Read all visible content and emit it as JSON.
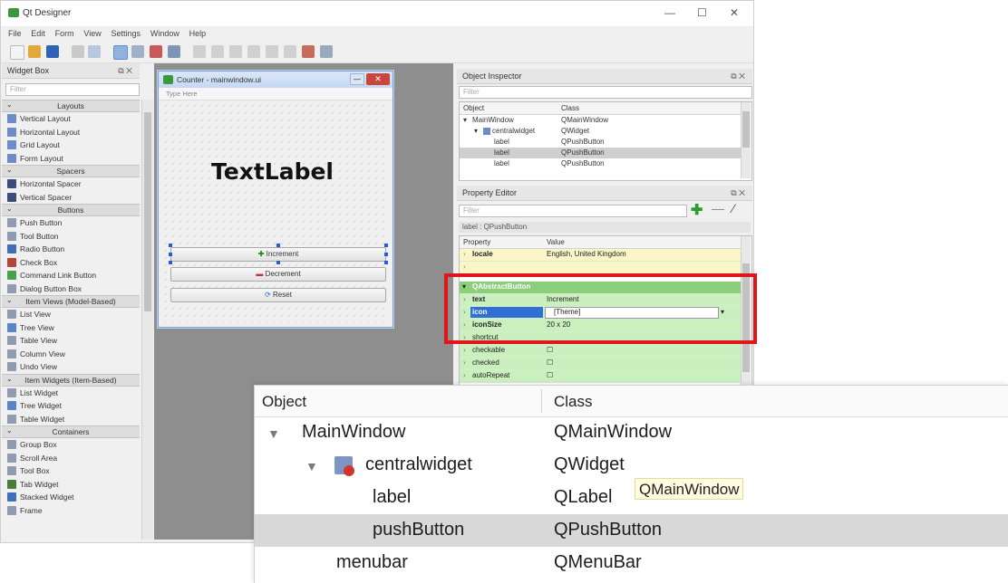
{
  "app": {
    "title": "Qt Designer",
    "minimize": "—",
    "maximize": "☐",
    "close": "✕"
  },
  "menu": [
    "File",
    "Edit",
    "Form",
    "View",
    "Settings",
    "Window",
    "Help"
  ],
  "widget_box": {
    "title": "Widget Box",
    "filter_placeholder": "Filter",
    "controls": "⧉ ✕",
    "entries": [
      {
        "kind": "cat",
        "label": "Layouts"
      },
      {
        "kind": "item",
        "label": "Vertical Layout",
        "color": "#6d8cc7"
      },
      {
        "kind": "item",
        "label": "Horizontal Layout",
        "color": "#6d8cc7"
      },
      {
        "kind": "item",
        "label": "Grid Layout",
        "color": "#6d8cc7"
      },
      {
        "kind": "item",
        "label": "Form Layout",
        "color": "#6d8cc7"
      },
      {
        "kind": "cat",
        "label": "Spacers"
      },
      {
        "kind": "item",
        "label": "Horizontal Spacer",
        "color": "#3b4b7a"
      },
      {
        "kind": "item",
        "label": "Vertical Spacer",
        "color": "#3b4b7a"
      },
      {
        "kind": "cat",
        "label": "Buttons"
      },
      {
        "kind": "item",
        "label": "Push Button",
        "color": "#8e9bb0"
      },
      {
        "kind": "item",
        "label": "Tool Button",
        "color": "#8e9bb0"
      },
      {
        "kind": "item",
        "label": "Radio Button",
        "color": "#3f6fb8"
      },
      {
        "kind": "item",
        "label": "Check Box",
        "color": "#b5463a"
      },
      {
        "kind": "item",
        "label": "Command Link Button",
        "color": "#4aa04a"
      },
      {
        "kind": "item",
        "label": "Dialog Button Box",
        "color": "#8e9bb0"
      },
      {
        "kind": "cat",
        "label": "Item Views (Model-Based)"
      },
      {
        "kind": "item",
        "label": "List View",
        "color": "#8e9bb0"
      },
      {
        "kind": "item",
        "label": "Tree View",
        "color": "#5a86c9"
      },
      {
        "kind": "item",
        "label": "Table View",
        "color": "#8e9bb0"
      },
      {
        "kind": "item",
        "label": "Column View",
        "color": "#8e9bb0"
      },
      {
        "kind": "item",
        "label": "Undo View",
        "color": "#8e9bb0"
      },
      {
        "kind": "cat",
        "label": "Item Widgets (Item-Based)"
      },
      {
        "kind": "item",
        "label": "List Widget",
        "color": "#8e9bb0"
      },
      {
        "kind": "item",
        "label": "Tree Widget",
        "color": "#5a86c9"
      },
      {
        "kind": "item",
        "label": "Table Widget",
        "color": "#8e9bb0"
      },
      {
        "kind": "cat",
        "label": "Containers"
      },
      {
        "kind": "item",
        "label": "Group Box",
        "color": "#8e9bb0"
      },
      {
        "kind": "item",
        "label": "Scroll Area",
        "color": "#8e9bb0"
      },
      {
        "kind": "item",
        "label": "Tool Box",
        "color": "#8e9bb0"
      },
      {
        "kind": "item",
        "label": "Tab Widget",
        "color": "#4a7c3a"
      },
      {
        "kind": "item",
        "label": "Stacked Widget",
        "color": "#3f6fb8"
      },
      {
        "kind": "item",
        "label": "Frame",
        "color": "#8e9bb0"
      }
    ]
  },
  "form": {
    "title": "Counter - mainwindow.ui",
    "menu_placeholder": "Type Here",
    "text_label": "TextLabel",
    "buttons": [
      "Increment",
      "Decrement",
      "Reset"
    ]
  },
  "object_inspector": {
    "title": "Object Inspector",
    "controls": "⧉ ✕",
    "filter_placeholder": "Filter",
    "col_object": "Object",
    "col_class": "Class",
    "rows": [
      {
        "object": "MainWindow",
        "class": "QMainWindow",
        "indent": 0,
        "arrow": "▾"
      },
      {
        "object": "centralwidget",
        "class": "QWidget",
        "indent": 1,
        "arrow": "▾"
      },
      {
        "object": "label",
        "class": "QPushButton",
        "indent": 2,
        "arrow": ""
      },
      {
        "object": "label",
        "class": "QPushButton",
        "indent": 2,
        "arrow": "",
        "selected": true
      },
      {
        "object": "label",
        "class": "QPushButton",
        "indent": 2,
        "arrow": ""
      }
    ]
  },
  "property_editor": {
    "title": "Property Editor",
    "controls": "⧉ ✕",
    "filter_placeholder": "Filter",
    "object_caption": "label : QPushButton",
    "col_property": "Property",
    "col_value": "Value",
    "rows": [
      {
        "name": "locale",
        "value": "English, United Kingdom",
        "bg": "#fbf6c8"
      },
      {
        "name": "",
        "value": "",
        "bg": "#fbf6c8"
      }
    ],
    "section": "QAbstractButton",
    "section_rows": [
      {
        "name": "text",
        "value": "Increment"
      },
      {
        "name": "icon",
        "value": "[Theme]",
        "selected": true
      },
      {
        "name": "iconSize",
        "value": "20 x 20"
      },
      {
        "name": "shortcut",
        "value": ""
      },
      {
        "name": "checkable",
        "value": "☐"
      },
      {
        "name": "checked",
        "value": "☐"
      },
      {
        "name": "autoRepeat",
        "value": "☐"
      }
    ]
  },
  "zoom": {
    "col_object": "Object",
    "col_class": "Class",
    "rows": [
      {
        "object": "MainWindow",
        "class": "QMainWindow",
        "arrow": "▼",
        "indent": 0
      },
      {
        "object": "centralwidget",
        "class": "QWidget",
        "arrow": "▼",
        "indent": 1,
        "icon": true
      },
      {
        "object": "label",
        "class": "QLabel",
        "arrow": "",
        "indent": 2
      },
      {
        "object": "pushButton",
        "class": "QPushButton",
        "arrow": "",
        "indent": 2,
        "selected": true
      },
      {
        "object": "menubar",
        "class": "QMenuBar",
        "arrow": "",
        "indent": 1
      }
    ],
    "tooltip": "QMainWindow"
  },
  "colors": {
    "highlight": "#e0161b",
    "green_row": "#c9f0bd",
    "green_section": "#8ccf7a",
    "selection_blue": "#2f6fd6",
    "row_selected": "#d8d8d8"
  }
}
